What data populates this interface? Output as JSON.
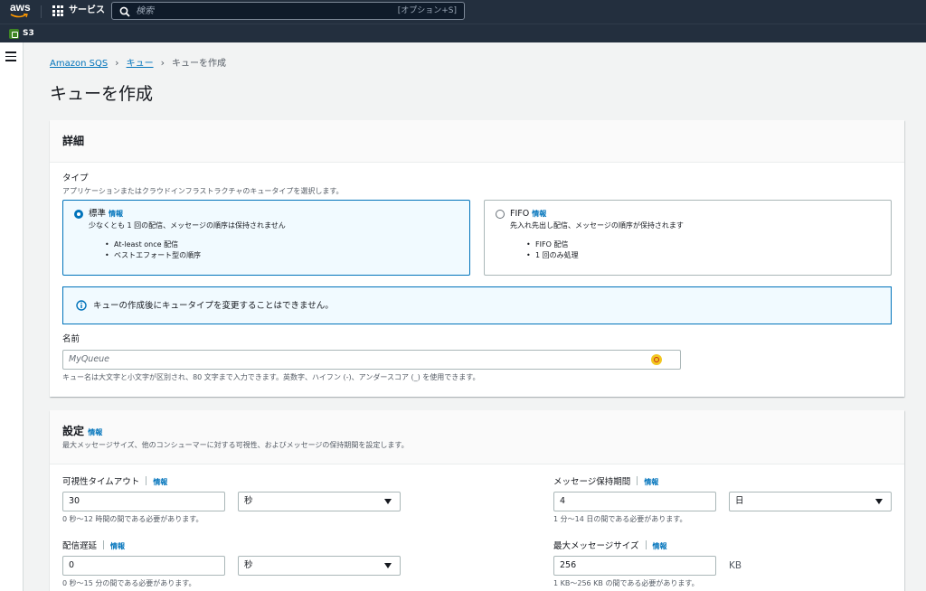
{
  "topnav": {
    "logo_text": "aws",
    "services_label": "サービス",
    "search_placeholder": "検索",
    "search_shortcut": "[オプション+S]"
  },
  "favorites": [
    {
      "label": "S3"
    }
  ],
  "breadcrumbs": [
    {
      "label": "Amazon SQS"
    },
    {
      "label": "キュー"
    },
    {
      "label": "キューを作成"
    }
  ],
  "page_title": "キューを作成",
  "details": {
    "title": "詳細",
    "type_label": "タイプ",
    "type_desc": "アプリケーションまたはクラウドインフラストラクチャのキュータイプを選択します。",
    "options": [
      {
        "title": "標準",
        "info": "情報",
        "selected": true,
        "description": "少なくとも 1 回の配信、メッセージの順序は保持されません",
        "bullets": [
          "At-least once 配信",
          "ベストエフォート型の順序"
        ]
      },
      {
        "title": "FIFO",
        "info": "情報",
        "selected": false,
        "description": "先入れ先出し配信、メッセージの順序が保持されます",
        "bullets": [
          "FIFO 配信",
          "1 回のみ処理"
        ]
      }
    ],
    "alert": "キューの作成後にキュータイプを変更することはできません。",
    "name_label": "名前",
    "name_placeholder": "MyQueue",
    "name_hint": "キュー名は大文字と小文字が区別され、80 文字まで入力できます。英数字、ハイフン (-)、アンダースコア (_) を使用できます。"
  },
  "settings": {
    "title": "設定",
    "info": "情報",
    "description": "最大メッセージサイズ、他のコンシューマーに対する可視性、およびメッセージの保持期間を設定します。",
    "visibility_timeout": {
      "label": "可視性タイムアウト",
      "info": "情報",
      "value": "30",
      "unit": "秒",
      "hint": "0 秒〜12 時間の間である必要があります。"
    },
    "retention_period": {
      "label": "メッセージ保持期間",
      "info": "情報",
      "value": "4",
      "unit": "日",
      "hint": "1 分〜14 日の間である必要があります。"
    },
    "delivery_delay": {
      "label": "配信遅延",
      "info": "情報",
      "value": "0",
      "unit": "秒",
      "hint": "0 秒〜15 分の間である必要があります。"
    },
    "max_message_size": {
      "label": "最大メッセージサイズ",
      "info": "情報",
      "value": "256",
      "unit": "KB",
      "hint": "1 KB〜256 KB の間である必要があります。"
    }
  },
  "colors": {
    "nav_bg": "#232f3e",
    "link": "#0073bb",
    "selected_bg": "#f1faff",
    "page_bg": "#f2f3f3"
  }
}
